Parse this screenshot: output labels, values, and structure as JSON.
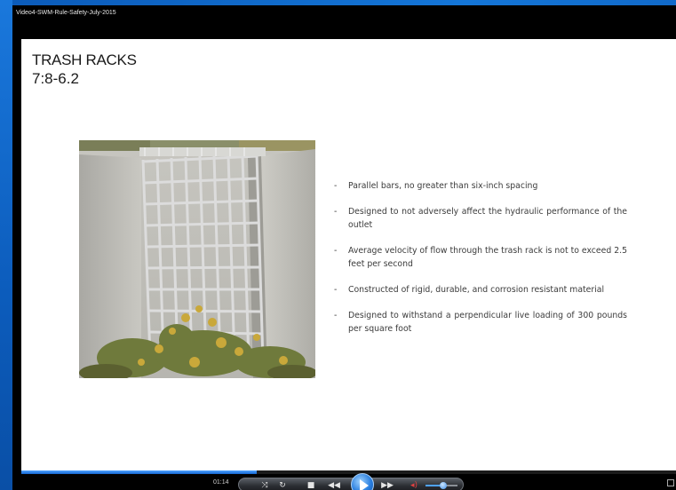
{
  "window": {
    "title": "Video4-SWM-Rule-Safety-July-2015"
  },
  "slide": {
    "title": "TRASH RACKS",
    "subtitle": "7:8-6.2",
    "photo_icon": "trash-rack-photo",
    "bullets": [
      "Parallel bars, no greater than six-inch spacing",
      "Designed to not adversely affect the hydraulic performance of the outlet",
      "Average velocity of flow through the trash rack is not to exceed 2.5 feet per second",
      "Constructed of rigid, durable, and corrosion resistant material",
      "Designed to withstand a perpendicular live loading of 300 pounds per square foot"
    ],
    "bullet_marker": "-"
  },
  "player": {
    "time": "01:14",
    "progress_fraction": 0.36,
    "volume_fraction": 0.55,
    "icons": {
      "shuffle": "shuffle-icon",
      "repeat": "repeat-icon",
      "stop": "stop-icon",
      "previous": "previous-icon",
      "play": "play-icon",
      "next": "next-icon",
      "mute": "speaker-icon",
      "fullscreen": "fullscreen-icon"
    },
    "accent_color": "#1f7be6"
  }
}
